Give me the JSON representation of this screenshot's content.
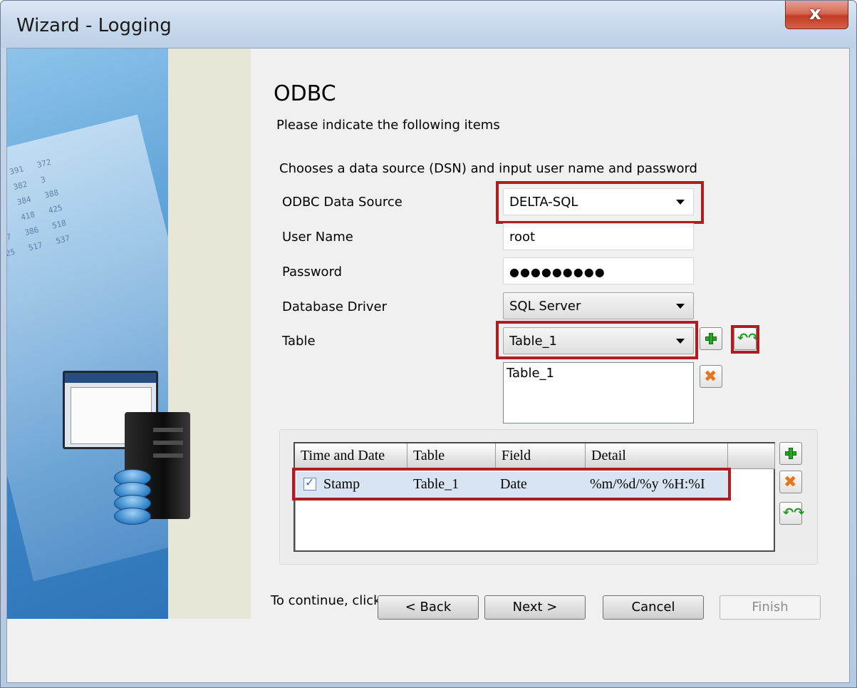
{
  "window": {
    "title": "Wizard - Logging",
    "close_label": "x"
  },
  "page": {
    "heading": "ODBC",
    "subheading": "Please indicate the following items",
    "instruction": "Chooses a data source (DSN) and input user name and password",
    "continue_text": "To continue, click Next."
  },
  "form": {
    "odbc_source_label": "ODBC Data Source",
    "odbc_source_value": "DELTA-SQL",
    "user_name_label": "User Name",
    "user_name_value": "root",
    "password_label": "Password",
    "password_value": "●●●●●●●●●",
    "driver_label": "Database Driver",
    "driver_value": "SQL Server",
    "table_label": "Table",
    "table_value": "Table_1",
    "table_list": [
      "Table_1"
    ]
  },
  "grid": {
    "columns": [
      "Time and Date",
      "Table",
      "Field",
      "Detail"
    ],
    "rows": [
      {
        "checked": true,
        "time_and_date": "Stamp",
        "table": "Table_1",
        "field": "Date",
        "detail": "%m/%d/%y %H:%I"
      }
    ]
  },
  "buttons": {
    "back": "< Back",
    "next": "Next >",
    "cancel": "Cancel",
    "finish": "Finish"
  },
  "icons": {
    "add": "plus-icon",
    "remove": "x-icon",
    "refresh": "refresh-icon",
    "close": "close-icon"
  },
  "colors": {
    "highlight": "#b01c20",
    "selected_row": "#d9e4f3",
    "title_bar": "#c8d9ec"
  }
}
